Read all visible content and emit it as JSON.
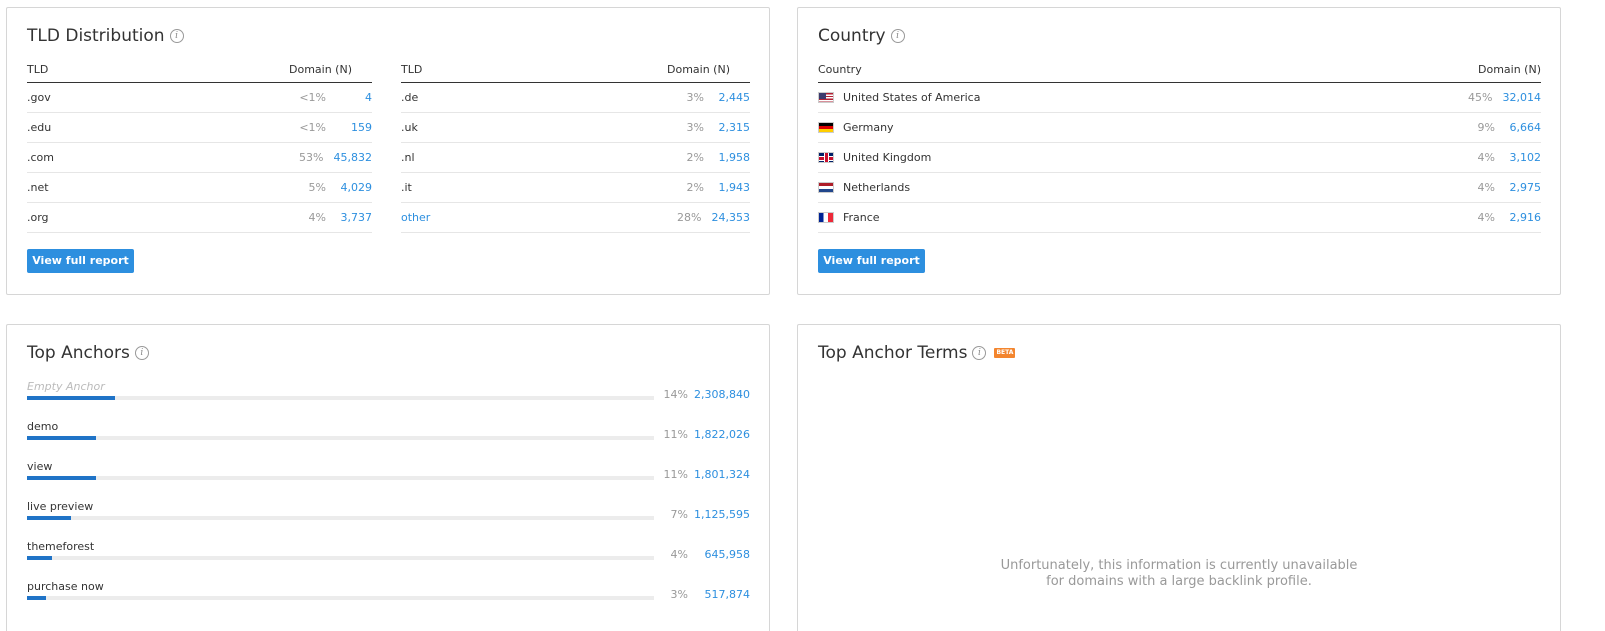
{
  "tld": {
    "title": "TLD Distribution",
    "col_tld": "TLD",
    "col_domain": "Domain (N)",
    "left_rows": [
      {
        "name": ".gov",
        "pct": "<1%",
        "num": "4"
      },
      {
        "name": ".edu",
        "pct": "<1%",
        "num": "159"
      },
      {
        "name": ".com",
        "pct": "53%",
        "num": "45,832"
      },
      {
        "name": ".net",
        "pct": "5%",
        "num": "4,029"
      },
      {
        "name": ".org",
        "pct": "4%",
        "num": "3,737"
      }
    ],
    "right_rows": [
      {
        "name": ".de",
        "pct": "3%",
        "num": "2,445"
      },
      {
        "name": ".uk",
        "pct": "3%",
        "num": "2,315"
      },
      {
        "name": ".nl",
        "pct": "2%",
        "num": "1,958"
      },
      {
        "name": ".it",
        "pct": "2%",
        "num": "1,943"
      },
      {
        "name": "other",
        "pct": "28%",
        "num": "24,353"
      }
    ],
    "button": "View full report"
  },
  "country": {
    "title": "Country",
    "col_country": "Country",
    "col_domain": "Domain (N)",
    "rows": [
      {
        "name": "United States of America",
        "flag": "us-flag-icon",
        "pct": "45%",
        "num": "32,014"
      },
      {
        "name": "Germany",
        "flag": "de-flag-icon",
        "pct": "9%",
        "num": "6,664"
      },
      {
        "name": "United Kingdom",
        "flag": "uk-flag-icon",
        "pct": "4%",
        "num": "3,102"
      },
      {
        "name": "Netherlands",
        "flag": "nl-flag-icon",
        "pct": "4%",
        "num": "2,975"
      },
      {
        "name": "France",
        "flag": "fr-flag-icon",
        "pct": "4%",
        "num": "2,916"
      }
    ],
    "button": "View full report"
  },
  "anchors": {
    "title": "Top Anchors",
    "items": [
      {
        "label": "Empty Anchor",
        "pct": "14%",
        "num": "2,308,840",
        "share": 14
      },
      {
        "label": "demo",
        "pct": "11%",
        "num": "1,822,026",
        "share": 11
      },
      {
        "label": "view",
        "pct": "11%",
        "num": "1,801,324",
        "share": 11
      },
      {
        "label": "live preview",
        "pct": "7%",
        "num": "1,125,595",
        "share": 7
      },
      {
        "label": "themeforest",
        "pct": "4%",
        "num": "645,958",
        "share": 4
      },
      {
        "label": "purchase now",
        "pct": "3%",
        "num": "517,874",
        "share": 3
      }
    ]
  },
  "anchor_terms": {
    "title": "Top Anchor Terms",
    "beta": "BETA",
    "message_line1": "Unfortunately, this information is currently unavailable",
    "message_line2": "for domains with a large backlink profile."
  },
  "colors": {
    "accent": "#2d8fdf",
    "bar_fill": "#1f73c7",
    "beta": "#f3852e"
  }
}
